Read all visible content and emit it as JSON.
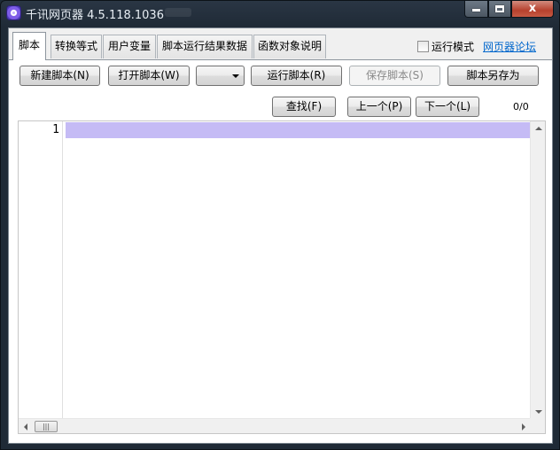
{
  "window": {
    "title": "千讯网页器 4.5.118.1036",
    "minimize_glyph": "",
    "close_glyph": "x"
  },
  "tabs": [
    {
      "label": "脚本",
      "active": true
    },
    {
      "label": "转换等式",
      "active": false
    },
    {
      "label": "用户变量",
      "active": false
    },
    {
      "label": "脚本运行结果数据",
      "active": false
    },
    {
      "label": "函数对象说明",
      "active": false
    }
  ],
  "header": {
    "run_mode_label": "运行模式",
    "run_mode_checked": false,
    "forum_link": "网页器论坛"
  },
  "toolbar": {
    "new_script": "新建脚本(N)",
    "open_script": "打开脚本(W)",
    "combo_value": "",
    "run_script": "运行脚本(R)",
    "save_script": "保存脚本(S)",
    "save_as": "脚本另存为"
  },
  "search": {
    "input_value": "",
    "find": "查找(F)",
    "prev": "上一个(P)",
    "next": "下一个(L)",
    "counter": "0/0"
  },
  "editor": {
    "line_numbers": [
      "1"
    ],
    "content": "",
    "hthumb_glyph": "|||"
  },
  "colors": {
    "line_highlight": "#c5bbf5",
    "link": "#0066cc"
  }
}
